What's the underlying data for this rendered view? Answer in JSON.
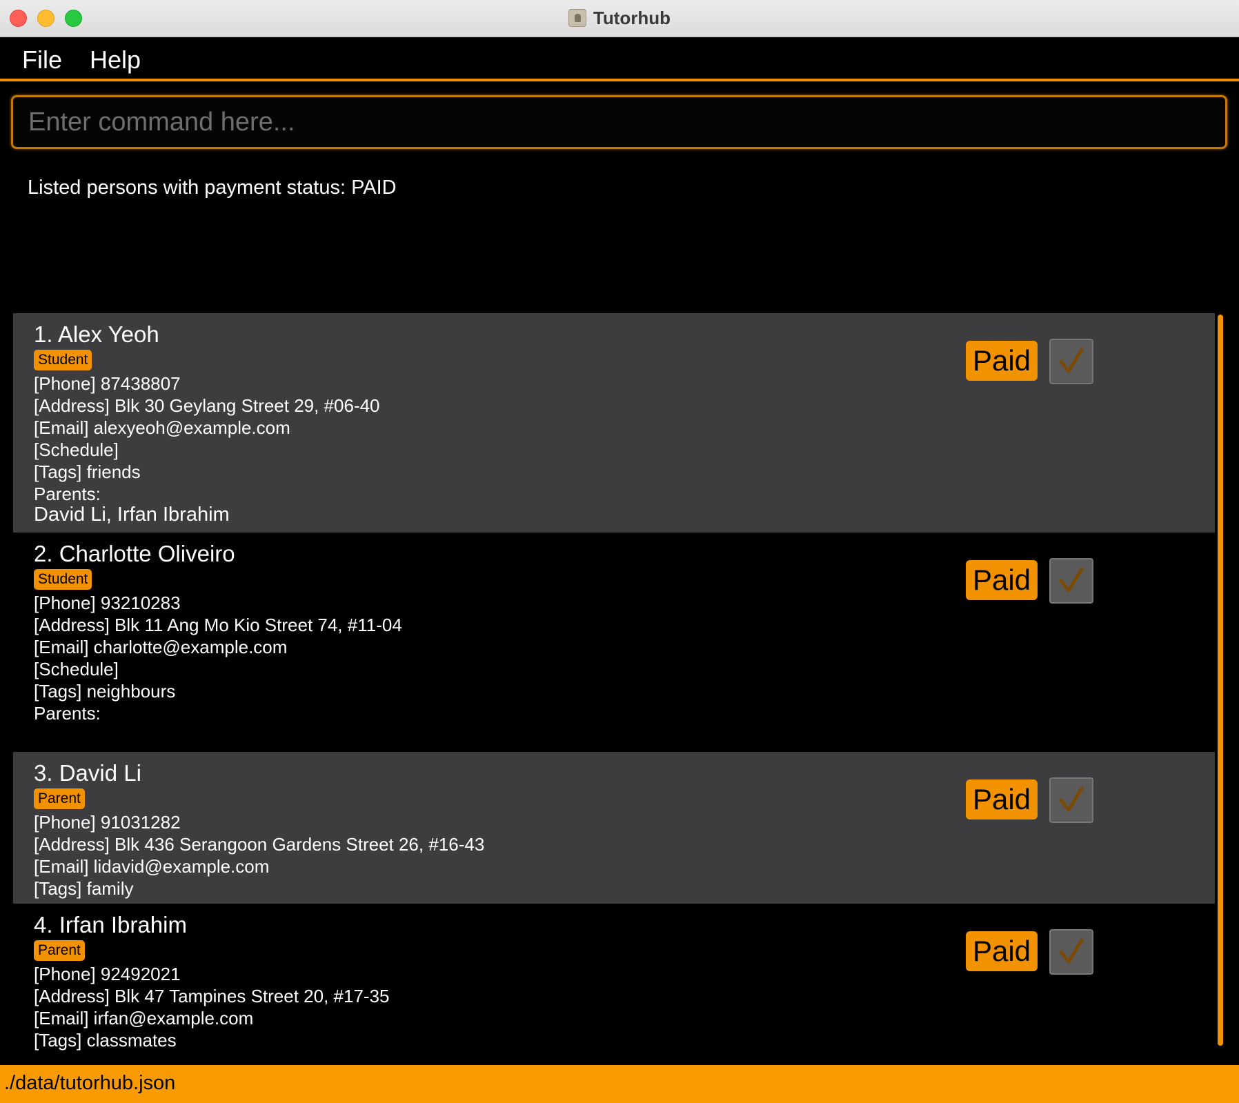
{
  "window": {
    "title": "Tutorhub"
  },
  "menu": {
    "file": "File",
    "help": "Help"
  },
  "command": {
    "placeholder": "Enter command here..."
  },
  "result": {
    "message": "Listed persons with payment status: PAID"
  },
  "persons": [
    {
      "name": "1. Alex Yeoh",
      "role": "Student",
      "phone": "[Phone] 87438807",
      "address": "[Address] Blk 30 Geylang Street 29, #06-40",
      "email": "[Email] alexyeoh@example.com",
      "schedule": "[Schedule]",
      "tags": "[Tags] friends",
      "parents_label": "Parents:",
      "parents": "David Li, Irfan Ibrahim",
      "payment": "Paid",
      "checked": true
    },
    {
      "name": "2. Charlotte Oliveiro",
      "role": "Student",
      "phone": "[Phone] 93210283",
      "address": "[Address] Blk 11 Ang Mo Kio Street 74, #11-04",
      "email": "[Email] charlotte@example.com",
      "schedule": "[Schedule]",
      "tags": "[Tags] neighbours",
      "parents_label": "Parents:",
      "parents": "",
      "payment": "Paid",
      "checked": true
    },
    {
      "name": "3. David Li",
      "role": "Parent",
      "phone": "[Phone] 91031282",
      "address": "[Address] Blk 436 Serangoon Gardens Street 26, #16-43",
      "email": "[Email] lidavid@example.com",
      "tags": "[Tags] family",
      "payment": "Paid",
      "checked": true
    },
    {
      "name": "4. Irfan Ibrahim",
      "role": "Parent",
      "phone": "[Phone] 92492021",
      "address": "[Address] Blk 47 Tampines Street 20, #17-35",
      "email": "[Email] irfan@example.com",
      "tags": "[Tags] classmates",
      "payment": "Paid",
      "checked": true
    }
  ],
  "status": {
    "path": "./data/tutorhub.json"
  },
  "colors": {
    "accent": "#f39200",
    "card_alt": "#3d3d3f",
    "check_mark": "#7a4a05"
  },
  "icons": {
    "check": "check-icon",
    "app": "contact-book-icon"
  }
}
